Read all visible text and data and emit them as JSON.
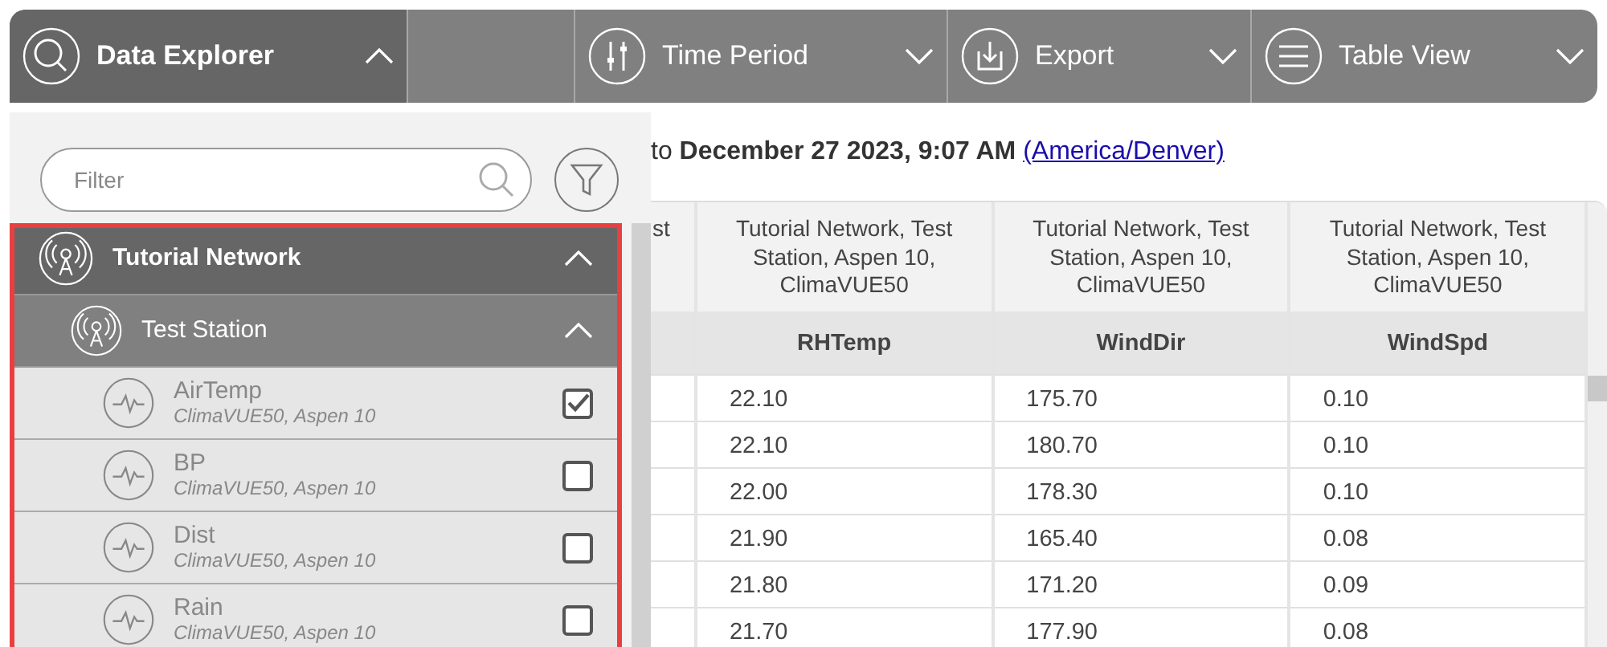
{
  "toolbar": [
    {
      "label": "Data Explorer",
      "expanded": true
    },
    {
      "label": "Time Period",
      "expanded": false
    },
    {
      "label": "Export",
      "expanded": false
    },
    {
      "label": "Table View",
      "expanded": false
    }
  ],
  "date_range": {
    "text": "to **December 27 2023, 9:07 AM**",
    "timezone": "(America/Denver)"
  },
  "table": {
    "columns": [
      {
        "group": "st"
      },
      {
        "group": "Tutorial Network, Test Station, Aspen 10, ClimaVUE50",
        "name": "RHTemp"
      },
      {
        "group": "Tutorial Network, Test Station, Aspen 10, ClimaVUE50",
        "name": "WindDir"
      },
      {
        "group": "Tutorial Network, Test Station, Aspen 10, ClimaVUE50",
        "name": "WindSpd"
      }
    ],
    "rows": [
      [
        "",
        "22.10",
        "175.70",
        "0.10"
      ],
      [
        "",
        "22.10",
        "180.70",
        "0.10"
      ],
      [
        "",
        "22.00",
        "178.30",
        "0.10"
      ],
      [
        "",
        "21.90",
        "165.40",
        "0.08"
      ],
      [
        "",
        "21.80",
        "171.20",
        "0.09"
      ],
      [
        "",
        "21.70",
        "177.90",
        "0.08"
      ]
    ]
  },
  "explorer": {
    "filter": {
      "placeholder": "Filter"
    },
    "highlighted": true,
    "tree": [
      {
        "name": "Tutorial Network",
        "expanded": true,
        "children": [
          {
            "name": "Test Station",
            "expanded": true,
            "children": [
              {
                "name": "AirTemp",
                "detail": "ClimaVUE50, Aspen 10",
                "checked": true
              },
              {
                "name": "BP",
                "detail": "ClimaVUE50, Aspen 10",
                "checked": false
              },
              {
                "name": "Dist",
                "detail": "ClimaVUE50, Aspen 10",
                "checked": false
              },
              {
                "name": "Rain",
                "detail": "ClimaVUE50, Aspen 10",
                "checked": false
              }
            ]
          }
        ]
      }
    ]
  }
}
